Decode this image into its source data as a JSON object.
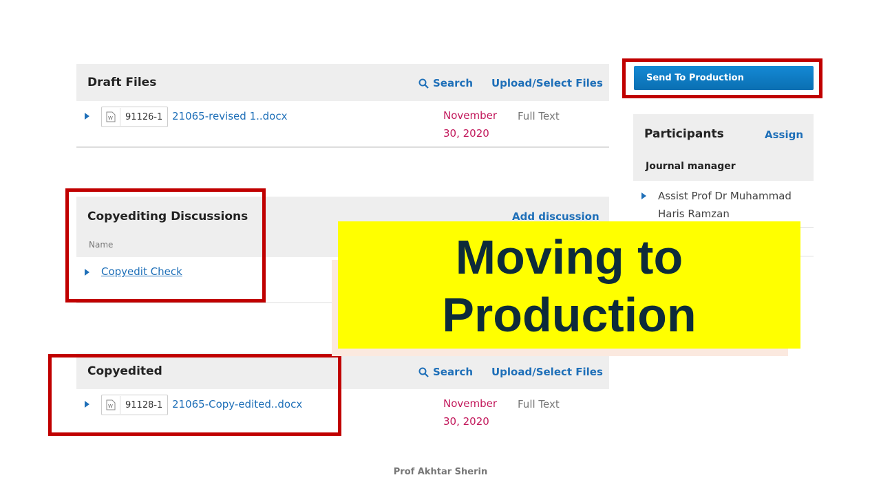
{
  "draft_files": {
    "title": "Draft Files",
    "search_label": "Search",
    "upload_label": "Upload/Select Files",
    "rows": [
      {
        "file_id": "91126-1",
        "file_name": "21065-revised 1..docx",
        "date_line1": "November",
        "date_line2": "30, 2020",
        "type": "Full Text"
      }
    ]
  },
  "send_to_production": {
    "label": "Send To Production"
  },
  "participants": {
    "title": "Participants",
    "assign_label": "Assign",
    "group_label": "Journal manager",
    "members": [
      {
        "line1": "Assist Prof Dr Muhammad",
        "line2": "Haris Ramzan"
      }
    ]
  },
  "copyediting_discussions": {
    "title": "Copyediting Discussions",
    "add_label": "Add discussion",
    "column_name": "Name",
    "items": [
      {
        "label": "Copyedit Check"
      }
    ]
  },
  "copyedited": {
    "title": "Copyedited",
    "search_label": "Search",
    "upload_label": "Upload/Select Files",
    "rows": [
      {
        "file_id": "91128-1",
        "file_name": "21065-Copy-edited..docx",
        "date_line1": "November",
        "date_line2": "30, 2020",
        "type": "Full Text"
      }
    ]
  },
  "overlay": {
    "line1": "Moving to",
    "line2": "Production",
    "background": "#ffff00",
    "text_color": "#0d2b3a"
  },
  "footer": {
    "author": "Prof Akhtar Sherin"
  },
  "colors": {
    "accent": "#1e6fb8",
    "date": "#c2185b",
    "highlight_border": "#c00000",
    "button": "#0a7cc6"
  }
}
